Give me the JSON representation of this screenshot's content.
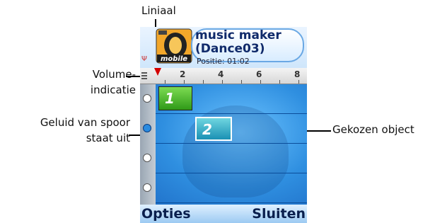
{
  "callouts": {
    "liniaal": "Liniaal",
    "volume_line1": "Volume-",
    "volume_line2": "indicatie",
    "track_sound_line1": "Geluid van spoor",
    "track_sound_line2": "staat uit",
    "selected_object": "Gekozen object"
  },
  "app": {
    "title_line1": "music maker",
    "title_line2": "(Dance03)",
    "position": "Positie: 01:02",
    "icon_text": "mobile"
  },
  "ruler": {
    "ticks": [
      "2",
      "4",
      "6",
      "8"
    ]
  },
  "objects": [
    {
      "label": "1",
      "track": 1
    },
    {
      "label": "2",
      "track": 2
    }
  ],
  "tracks": [
    {
      "sound": "on"
    },
    {
      "sound": "off"
    },
    {
      "sound": "on"
    },
    {
      "sound": "on"
    }
  ],
  "softkeys": {
    "left": "Opties",
    "right": "Sluiten"
  },
  "colors": {
    "accent": "#3a9be0",
    "marker": "#d40000",
    "object1": "#2f9a18",
    "object2": "#1a90b4"
  }
}
